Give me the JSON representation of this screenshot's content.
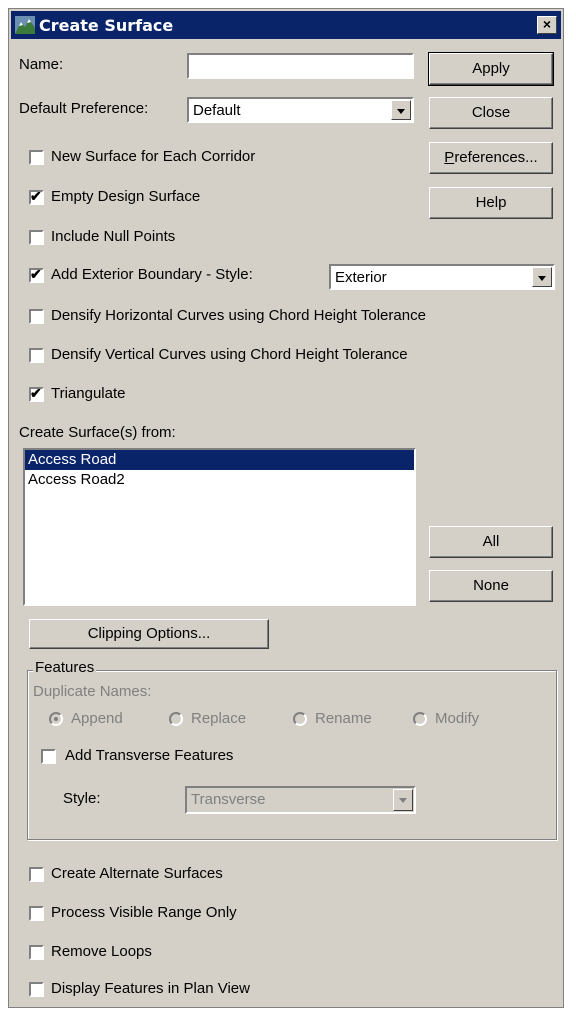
{
  "window": {
    "title": "Create Surface",
    "close_glyph": "×"
  },
  "form": {
    "name_label": "Name:",
    "name_value": "",
    "default_pref_label": "Default Preference:",
    "default_pref_value": "Default"
  },
  "buttons": {
    "apply": "Apply",
    "close": "Close",
    "preferences_mnemonic": "P",
    "preferences_rest": "references...",
    "help": "Help",
    "all": "All",
    "none": "None",
    "clipping": "Clipping Options..."
  },
  "options": [
    {
      "label": "New Surface for Each Corridor",
      "checked": false
    },
    {
      "label": "Empty Design Surface",
      "checked": true
    },
    {
      "label": "Include Null Points",
      "checked": false
    },
    {
      "label": "Add Exterior Boundary - Style:",
      "checked": true
    },
    {
      "label": "Densify Horizontal Curves using Chord Height Tolerance",
      "checked": false
    },
    {
      "label": "Densify Vertical Curves using Chord Height Tolerance",
      "checked": false
    },
    {
      "label": "Triangulate",
      "checked": true
    }
  ],
  "exterior_style_value": "Exterior",
  "create_from": {
    "label": "Create Surface(s) from:",
    "items": [
      "Access Road",
      "Access Road2"
    ],
    "selected_index": 0
  },
  "features": {
    "title": "Features",
    "duplicate_label": "Duplicate Names:",
    "radios": [
      "Append",
      "Replace",
      "Rename",
      "Modify"
    ],
    "selected_radio": 0,
    "add_transverse_label": "Add Transverse Features",
    "add_transverse_checked": false,
    "style_label": "Style:",
    "style_value": "Transverse"
  },
  "bottom_options": [
    {
      "label": "Create Alternate Surfaces",
      "checked": false
    },
    {
      "label": "Process Visible Range Only",
      "checked": false
    },
    {
      "label": "Remove Loops",
      "checked": false
    },
    {
      "label": "Display Features in Plan View",
      "checked": false
    }
  ],
  "check_glyph": "✔"
}
